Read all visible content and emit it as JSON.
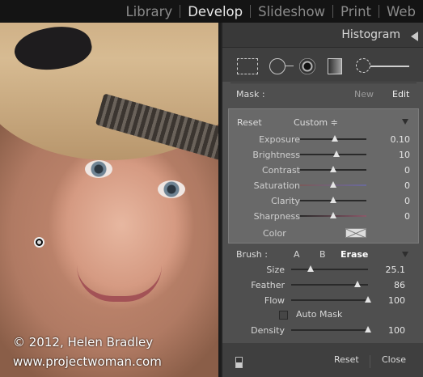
{
  "modules": [
    "Library",
    "Develop",
    "Slideshow",
    "Print",
    "Web"
  ],
  "active_module": "Develop",
  "photo": {
    "credit_line1": "© 2012, Helen Bradley",
    "credit_line2": "www.projectwoman.com"
  },
  "histogram": {
    "title": "Histogram"
  },
  "tools": [
    "crop-overlay-icon",
    "spot-removal-icon",
    "red-eye-icon",
    "graduated-filter-icon",
    "adjustment-brush-icon"
  ],
  "mask": {
    "label": "Mask :",
    "new": "New",
    "edit": "Edit"
  },
  "effect": {
    "reset": "Reset",
    "preset": "Custom ≑",
    "sliders": [
      {
        "name": "Exposure",
        "value": "0.10",
        "level": 0.52
      },
      {
        "name": "Brightness",
        "value": "10",
        "level": 0.55
      },
      {
        "name": "Contrast",
        "value": "0",
        "level": 0.5
      },
      {
        "name": "Saturation",
        "value": "0",
        "level": 0.5
      },
      {
        "name": "Clarity",
        "value": "0",
        "level": 0.5
      },
      {
        "name": "Sharpness",
        "value": "0",
        "level": 0.5
      }
    ],
    "color_label": "Color"
  },
  "brush": {
    "label": "Brush :",
    "a": "A",
    "b": "B",
    "erase": "Erase",
    "sliders": [
      {
        "name": "Size",
        "value": "25.1",
        "level": 0.25
      },
      {
        "name": "Feather",
        "value": "86",
        "level": 0.86
      },
      {
        "name": "Flow",
        "value": "100",
        "level": 1.0
      }
    ],
    "auto_mask": "Auto Mask",
    "density": {
      "name": "Density",
      "value": "100",
      "level": 1.0
    }
  },
  "footer": {
    "reset": "Reset",
    "close": "Close"
  }
}
